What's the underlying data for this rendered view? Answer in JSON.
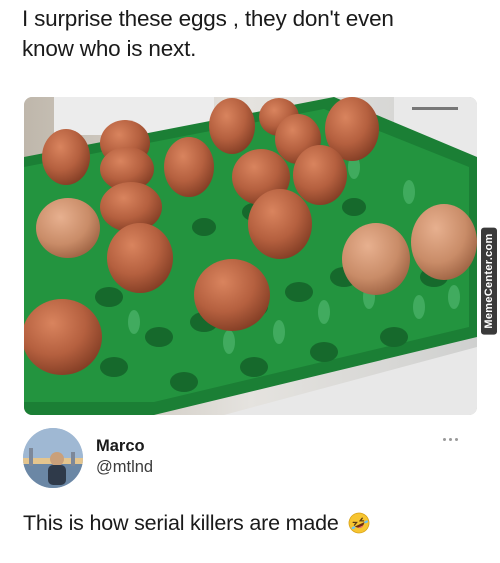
{
  "caption": {
    "line1": "I surprise these eggs , they don't even",
    "line2": "know who is next."
  },
  "photo": {
    "subject": "eggs in green egg tray",
    "watermark": "MemeCenter.com"
  },
  "tweet": {
    "display_name": "Marco",
    "handle": "@mtlnd",
    "text": "This is how serial killers are made",
    "emoji_icon": "rolling-on-floor-laughing-emoji"
  },
  "colors": {
    "tray_green": "#1f8a3a",
    "egg_brown": "#b8603f",
    "text": "#1a1a1a"
  }
}
